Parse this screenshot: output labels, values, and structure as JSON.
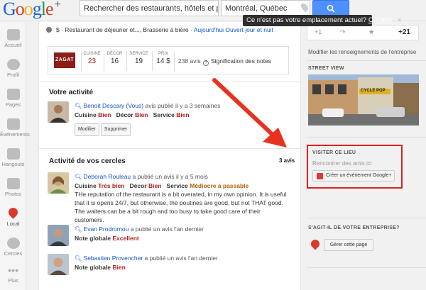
{
  "header": {
    "logo_text": "Google",
    "logo_plus": "+",
    "search_query": "Rechercher des restaurants, hôtels et plus e",
    "location_value": "Montréal, Québec",
    "tooltip_text": "Ce n'est pas votre emplacement actuel?",
    "tooltip_link": "Corriger",
    "tooltip_close": "×"
  },
  "nav": {
    "items": [
      {
        "label": "Accueil",
        "icon": "home-icon"
      },
      {
        "label": "Profil",
        "icon": "profile-icon"
      },
      {
        "label": "Pages",
        "icon": "pages-icon"
      },
      {
        "label": "Événements",
        "icon": "events-icon"
      },
      {
        "label": "Hangouts",
        "icon": "hangouts-icon"
      },
      {
        "label": "Photos",
        "icon": "photos-icon"
      },
      {
        "label": "Local",
        "icon": "local-pin-icon"
      },
      {
        "label": "Cercles",
        "icon": "circles-icon"
      },
      {
        "label": "Plus",
        "icon": "more-icon"
      }
    ]
  },
  "place": {
    "price": "$",
    "categories": "Restaurant de déjeuner et..., Brasserie à bière",
    "hours": "Aujourd'hui Ouvert jour et nuit",
    "zagat": {
      "logo": "ZAGAT",
      "scores": [
        {
          "label": "CUISINE",
          "value": "23"
        },
        {
          "label": "DÉCOR",
          "value": "16"
        },
        {
          "label": "SERVICE",
          "value": "19"
        },
        {
          "label": "PRIX",
          "value": "14 $"
        }
      ],
      "review_count": "238 avis",
      "notes_link": "Signification des notes"
    }
  },
  "my_activity": {
    "title": "Votre activité",
    "review": {
      "name": "Benoit Descary (Vous)",
      "meta": "avis publié il y a 3 semaines",
      "ratings": [
        {
          "label": "Cuisine",
          "value": "Bien"
        },
        {
          "label": "Décor",
          "value": "Bien"
        },
        {
          "label": "Service",
          "value": "Bien"
        }
      ],
      "edit_label": "Modifier",
      "delete_label": "Supprimer"
    }
  },
  "circles": {
    "title": "Activité de vos cercles",
    "count": "3 avis",
    "reviews": [
      {
        "name": "Deborah Rouleau",
        "meta": "a publié un avis il y a 5 mois",
        "ratings": [
          {
            "label": "Cuisine",
            "value": "Très bien"
          },
          {
            "label": "Décor",
            "value": "Bien"
          },
          {
            "label": "Service",
            "value": "Médiocre à passable"
          }
        ],
        "text": "THe reputation of the restaurant is a bit overated, in my own opinion. It is useful that it is opens 24/7, but otherwise, the poutines are good, but not THAT good. The waiters can be a bit rough and too busy to take good care of their customers."
      },
      {
        "name": "Evan Prodromou",
        "meta": "a publié un avis l'an dernier",
        "overall_label": "Note globale",
        "overall_value": "Excellent"
      },
      {
        "name": "Sebastien Provencher",
        "meta": "a publié un avis l'an dernier",
        "overall_label": "Note globale",
        "overall_value": "Bien"
      }
    ]
  },
  "sidebar": {
    "share": {
      "plus_one": "+1",
      "share": "↷",
      "star": "★",
      "count": "+21"
    },
    "edit_link": "Modifier les renseignements de l'entreprise",
    "street_view_title": "STREET VIEW",
    "street_sign": "CYCLE POP",
    "visit": {
      "title": "VISITER CE LIEU",
      "subtitle": "Rencontrer des amis ici",
      "button": "Créer un événement Google+"
    },
    "owner": {
      "title": "S'AGIT-IL DE VOTRE ENTREPRISE?",
      "button": "Gérer cette page"
    }
  },
  "colors": {
    "accent_blue": "#4d90fe",
    "link_blue": "#1155cc",
    "highlight_red": "#e02020",
    "zagat_red": "#8c1d18"
  }
}
